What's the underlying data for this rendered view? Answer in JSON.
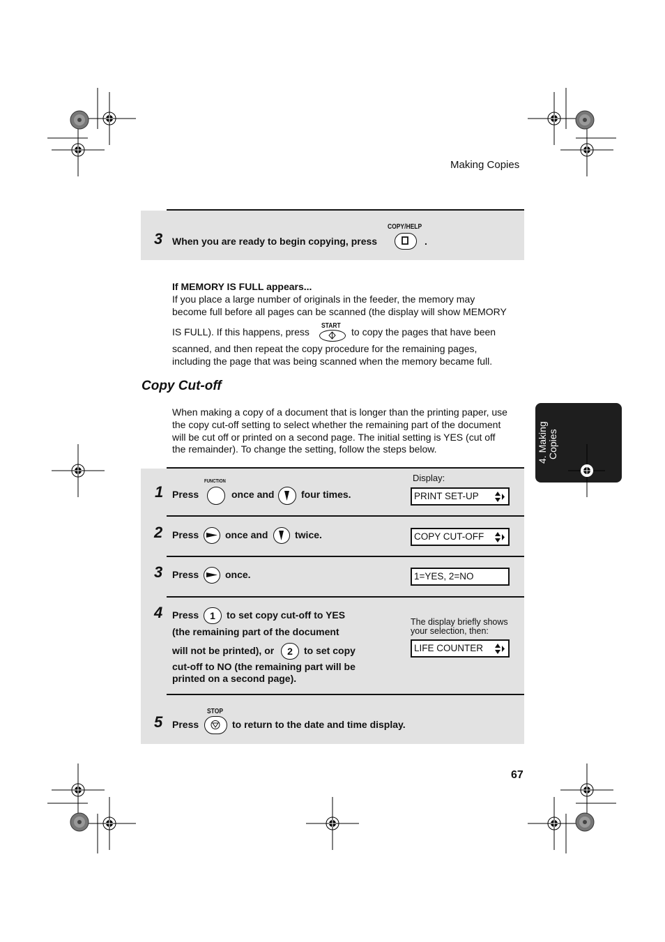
{
  "header": {
    "title": "Making Copies"
  },
  "top_step": {
    "number": "3",
    "text": "When you are ready to begin copying, press",
    "key_label": "COPY/HELP",
    "key_icon": "copy-help-key-icon",
    "trailing": "."
  },
  "memory_note": {
    "heading": "If MEMORY IS FULL appears...",
    "line1": "If you place a large number of originals in the feeder, the memory may",
    "line2": "become full before all pages can be scanned (the display will show MEMORY",
    "line3a": "IS FULL). If this happens, press",
    "key_label": "START",
    "line3b": "to copy the pages that have been",
    "line4": "scanned, and then repeat the copy procedure for the remaining pages,",
    "line5": "including the page that was being scanned when the memory became full."
  },
  "section": {
    "title": "Copy Cut-off",
    "intro": [
      "When making a copy of a document that is longer than the printing paper, use",
      "the copy cut-off setting to select whether the remaining part of the document",
      "will be cut off or printed on a second page. The initial setting is YES (cut off",
      "the remainder). To change the setting, follow the steps below."
    ]
  },
  "steps": [
    {
      "number": "1",
      "press": "Press",
      "key_label": "FUNCTION",
      "mid": "once and",
      "end": "four times.",
      "display_label": "Display:",
      "display": "PRINT SET-UP"
    },
    {
      "number": "2",
      "press": "Press",
      "mid": "once and",
      "end": "twice.",
      "display": "COPY CUT-OFF"
    },
    {
      "number": "3",
      "press": "Press",
      "end": "once.",
      "display": "1=YES, 2=NO"
    },
    {
      "number": "4",
      "press": "Press",
      "key1": "1",
      "line1": "to set copy cut-off to YES",
      "line2": "(the remaining part of the document",
      "line3a": "will not be printed), or",
      "key2": "2",
      "line3b": "to set copy",
      "line4": "cut-off to NO (the remaining part will be",
      "line5": "printed on a second page).",
      "note": [
        "The display briefly shows",
        "your selection, then:"
      ],
      "display": "LIFE COUNTER"
    },
    {
      "number": "5",
      "press": "Press",
      "key_label": "STOP",
      "end": "to return to the date and time display."
    }
  ],
  "side_tab": {
    "line1": "4. Making",
    "line2": "Copies"
  },
  "footer": {
    "page_number": "67"
  },
  "colors": {
    "panel": "#e2e2e2",
    "tab": "#1e1e1e",
    "text": "#111111"
  }
}
